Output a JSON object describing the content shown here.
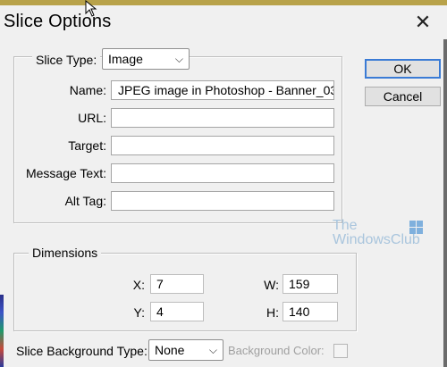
{
  "window": {
    "title": "Slice Options"
  },
  "slice_type": {
    "label": "Slice Type:",
    "value": "Image"
  },
  "fields": [
    {
      "label": "Name:",
      "value": "JPEG image in Photoshop - Banner_03"
    },
    {
      "label": "URL:",
      "value": ""
    },
    {
      "label": "Target:",
      "value": ""
    },
    {
      "label": "Message Text:",
      "value": ""
    },
    {
      "label": "Alt Tag:",
      "value": ""
    }
  ],
  "buttons": {
    "ok": "OK",
    "cancel": "Cancel"
  },
  "dimensions": {
    "legend": "Dimensions",
    "x_label": "X:",
    "x": "7",
    "y_label": "Y:",
    "y": "4",
    "w_label": "W:",
    "w": "159",
    "h_label": "H:",
    "h": "140"
  },
  "background": {
    "type_label": "Slice Background Type:",
    "type_value": "None",
    "color_label": "Background Color:"
  },
  "watermark": {
    "line1": "The",
    "line2": "WindowsClub"
  },
  "icons": {
    "close": "close-icon",
    "dropdown": "chevron-down-icon",
    "cursor": "mouse-pointer-icon",
    "logo": "windows-logo-icon"
  },
  "colors": {
    "default_button_border": "#3a7bd5",
    "watermark": "#a9c5dd"
  }
}
